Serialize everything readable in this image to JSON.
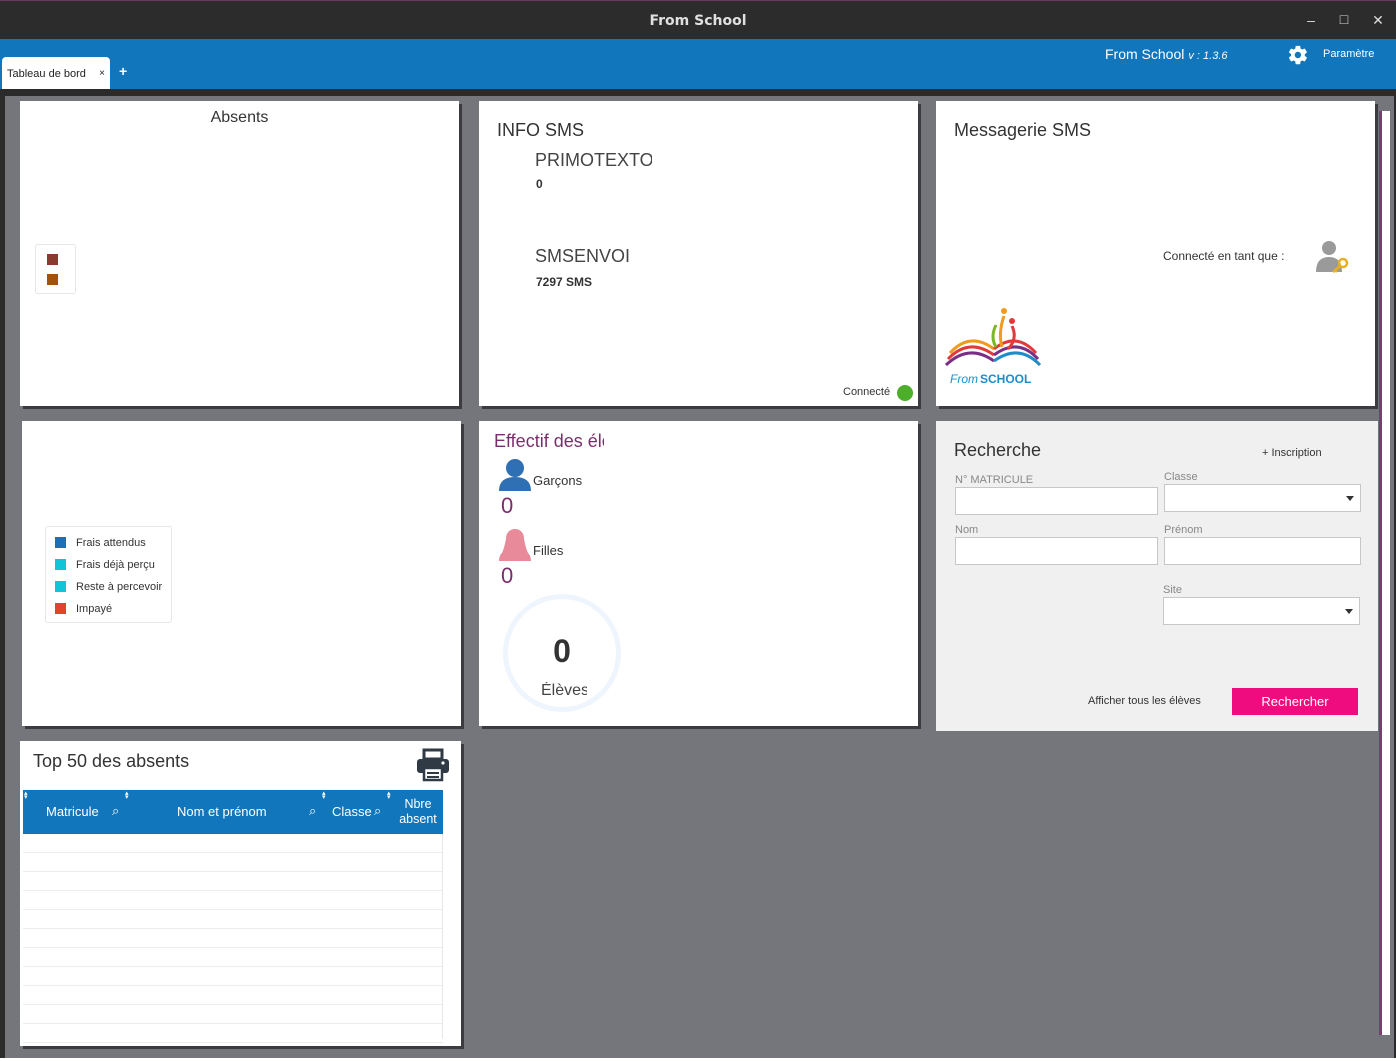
{
  "window": {
    "title": "From School"
  },
  "tabs": [
    {
      "label": "Tableau de bord",
      "close": "×"
    }
  ],
  "tab_add": "+",
  "brand": {
    "name": "From School",
    "version": "v : 1.3.6"
  },
  "settings": {
    "label": "Paramètre",
    "icon": "gear-icon"
  },
  "absents": {
    "title": "Absents",
    "legend_colors": [
      "#8b3a2f",
      "#a0520f"
    ]
  },
  "info_sms": {
    "title": "INFO SMS",
    "providers": [
      {
        "name": "PRIMOTEXTO",
        "value": "0"
      },
      {
        "name": "SMSENVOI",
        "value": "7297 SMS"
      }
    ],
    "status": "Connecté",
    "status_color": "#4caf2a"
  },
  "messagerie": {
    "title": "Messagerie SMS",
    "connected_as": "Connecté en tant que :",
    "logo": {
      "from": "From",
      "school": "SCHOOL"
    }
  },
  "frais": {
    "legend": [
      {
        "label": "Frais attendus",
        "color": "#1f6fb5"
      },
      {
        "label": "Frais déjà perçu",
        "color": "#12c4d8"
      },
      {
        "label": "Reste à percevoir",
        "color": "#12c4d8"
      },
      {
        "label": "Impayé",
        "color": "#e0442a"
      }
    ]
  },
  "effectif": {
    "title": "Effectif des élèves",
    "boys": {
      "label": "Garçons",
      "value": "0"
    },
    "girls": {
      "label": "Filles",
      "value": "0"
    },
    "total": {
      "value": "0",
      "label": "Élèves"
    }
  },
  "recherche": {
    "title": "Recherche",
    "inscription": "+ Inscription",
    "fields": {
      "matricule": "N° MATRICULE",
      "classe": "Classe",
      "nom": "Nom",
      "prenom": "Prénom",
      "site": "Site"
    },
    "show_all": "Afficher tous les élèves",
    "search_btn": "Rechercher"
  },
  "top50": {
    "title": "Top 50 des absents",
    "columns": [
      "Matricule",
      "Nom et prénom",
      "Classe",
      "Nbre absent"
    ]
  }
}
